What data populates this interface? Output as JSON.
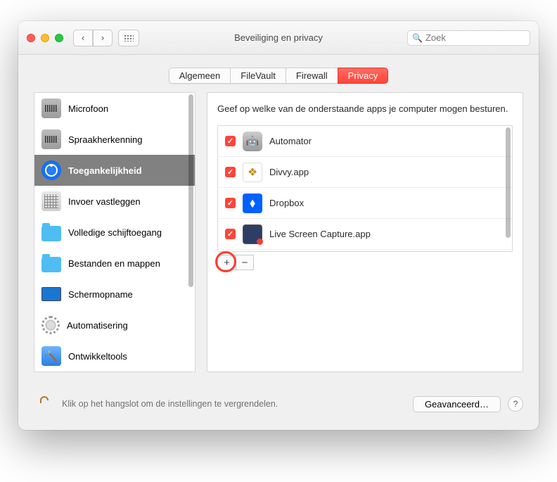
{
  "window": {
    "title": "Beveiliging en privacy"
  },
  "search": {
    "placeholder": "Zoek"
  },
  "tabs": [
    {
      "label": "Algemeen"
    },
    {
      "label": "FileVault"
    },
    {
      "label": "Firewall"
    },
    {
      "label": "Privacy",
      "active": true
    }
  ],
  "sidebar": {
    "items": [
      {
        "label": "Microfoon",
        "icon": "microphone"
      },
      {
        "label": "Spraakherkenning",
        "icon": "speech"
      },
      {
        "label": "Toegankelijkheid",
        "icon": "accessibility",
        "selected": true
      },
      {
        "label": "Invoer vastleggen",
        "icon": "keyboard"
      },
      {
        "label": "Volledige schijftoegang",
        "icon": "folder"
      },
      {
        "label": "Bestanden en mappen",
        "icon": "folder"
      },
      {
        "label": "Schermopname",
        "icon": "monitor"
      },
      {
        "label": "Automatisering",
        "icon": "gear"
      },
      {
        "label": "Ontwikkeltools",
        "icon": "hammer"
      }
    ]
  },
  "pane": {
    "description": "Geef op welke van de onderstaande apps je computer mogen besturen.",
    "apps": [
      {
        "name": "Automator",
        "checked": true
      },
      {
        "name": "Divvy.app",
        "checked": true
      },
      {
        "name": "Dropbox",
        "checked": true
      },
      {
        "name": "Live Screen Capture.app",
        "checked": true
      }
    ]
  },
  "footer": {
    "lockText": "Klik op het hangslot om de instellingen te vergrendelen.",
    "advanced": "Geavanceerd…",
    "help": "?"
  },
  "buttons": {
    "add": "+",
    "remove": "−"
  }
}
